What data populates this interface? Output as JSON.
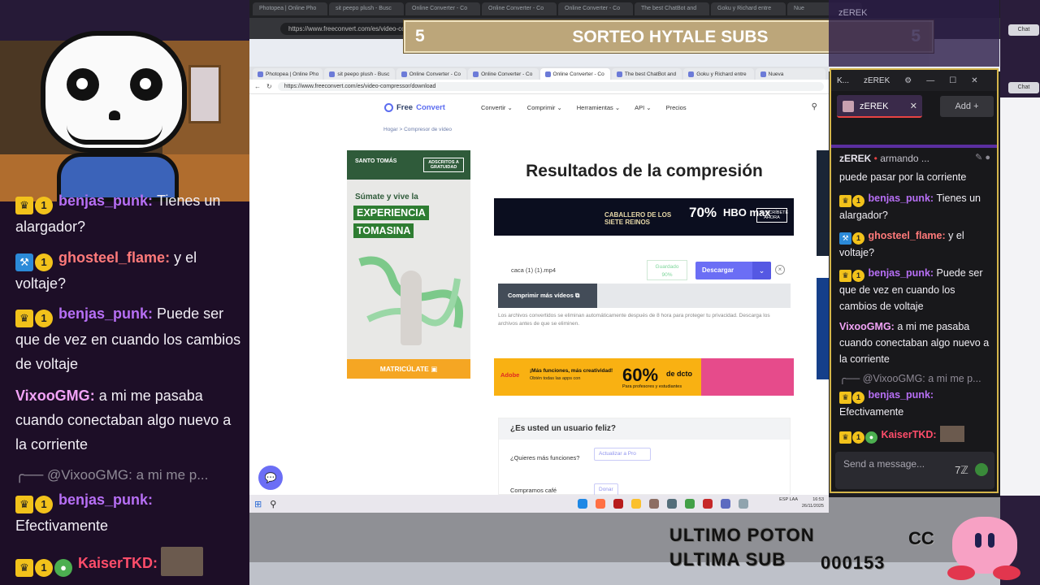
{
  "banner": {
    "left_number": "5",
    "title": "SORTEO HYTALE SUBS",
    "right_number": "5"
  },
  "bg_echo": {
    "tabs": [
      "Photopea | Online Pho",
      "sit peepo plush - Busc",
      "Online Converter - Co",
      "Online Converter - Co",
      "Online Converter - Co",
      "The best ChatBot and",
      "Goku y Richard entre",
      "Nue"
    ],
    "url": "https://www.freeconvert.com/es/video-compressor/download"
  },
  "browser": {
    "tabs": [
      "Photopea | Online Pho",
      "sit peepo plush - Busc",
      "Online Converter - Co",
      "Online Converter - Co",
      "Online Converter - Co",
      "The best ChatBot and",
      "Goku y Richard entre",
      "Nueva"
    ],
    "url": "https://www.freeconvert.com/es/video-compressor/download",
    "nav": {
      "logo_prefix": "Free",
      "logo_suffix": "Convert",
      "items": [
        "Convertir ⌄",
        "Comprimir ⌄",
        "Herramientas ⌄",
        "API ⌄",
        "Precios"
      ]
    },
    "breadcrumb": "Hogar   >   Compresor de vídeo",
    "ad_left": {
      "univ": "SANTO TOMÁS",
      "badge": "ADSCRITOS A GRATUIDAD",
      "line1": "Súmate y vive la",
      "line2": "EXPERIENCIA",
      "line3": "TOMASINA",
      "cta": "MATRICÚLATE ▣"
    },
    "results_title": "Resultados de la compresión",
    "hbo_ad": {
      "text": "CABALLERO DE LOS SIETE REINOS",
      "percent": "70%",
      "brand": "HBO max",
      "subscribe": "SUSCRÍBETE AHORA"
    },
    "file": {
      "name": "caca (1) (1).mp4",
      "saved_label": "Guardado",
      "saved_value": "90%",
      "download": "Descargar",
      "caret": "⌄",
      "close": "×"
    },
    "compress_more": "Comprimir más vídeos ⧉",
    "notice": "Los archivos convertidos se eliminan automáticamente después de 8 hora para proteger tu privacidad. Descarga los archivos antes de que se eliminen.",
    "adobe_ad": {
      "logo": "Adobe",
      "line1": "¡Más funciones, más creatividad!",
      "line2": "Obtén todas las apps con",
      "percent": "60%",
      "dcto": "de dcto",
      "sub": "Para profesores y estudiantes"
    },
    "happy": {
      "title": "¿Es usted un usuario feliz?",
      "row1": "¿Quieres más funciones?",
      "row1_btn": "Actualizar a Pro",
      "row2": "Compramos café",
      "row2_btn": "Donar"
    },
    "chat_bubble": "💬"
  },
  "taskbar": {
    "start": "⊞",
    "search": "⚲",
    "lang": "ESP LAA",
    "time": "16:53",
    "date": "26/11/2025"
  },
  "left_chat": [
    {
      "badges": [
        "crown",
        "1"
      ],
      "user": "benjas_punk",
      "text": "Tienes un alargador?",
      "color": "#b76ff5"
    },
    {
      "badges": [
        "hammer",
        "1"
      ],
      "user": "ghosteel_flame",
      "text": "y el voltaje?",
      "color": "#ff7a7a"
    },
    {
      "badges": [
        "crown",
        "1"
      ],
      "user": "benjas_punk",
      "text": "Puede ser que de vez en cuando los cambios de voltaje",
      "color": "#b76ff5"
    },
    {
      "badges": [],
      "user": "VixooGMG",
      "text": "a mi me pasaba cuando conectaban algo nuevo a la corriente",
      "color": "#f2a3f7"
    },
    {
      "reply": "╭── @VixooGMG: a mi me p..."
    },
    {
      "badges": [
        "crown",
        "1"
      ],
      "user": "benjas_punk",
      "text": "Efectivamente",
      "color": "#b76ff5"
    },
    {
      "badges": [
        "crown",
        "1",
        "frog"
      ],
      "user": "KaiserTKD",
      "text": "",
      "color": "#ff4d6a"
    }
  ],
  "right_chat": {
    "title": "zEREK",
    "title_prefix": "K...",
    "gear": "⚙",
    "min": "—",
    "max": "☐",
    "close": "✕",
    "tab": "zEREK",
    "tab_close": "✕",
    "add": "Add  +",
    "ghost_text": "zEREK",
    "streamer": "zEREK",
    "status": "armando ...",
    "messages": [
      {
        "user": "",
        "text": "puede pasar por la corriente",
        "color": "#efedf3",
        "badges": []
      },
      {
        "user": "benjas_punk",
        "text": "Tienes un alargador?",
        "color": "#b76ff5",
        "badges": [
          "crown",
          "1"
        ]
      },
      {
        "user": "ghosteel_flame",
        "text": "y el voltaje?",
        "color": "#ff7a7a",
        "badges": [
          "hammer",
          "1"
        ]
      },
      {
        "user": "benjas_punk",
        "text": "Puede ser que de vez en cuando los cambios de voltaje",
        "color": "#b76ff5",
        "badges": [
          "crown",
          "1"
        ]
      },
      {
        "user": "VixooGMG",
        "text": "a mi me pasaba cuando conectaban algo nuevo a la corriente",
        "color": "#f2a3f7",
        "badges": []
      },
      {
        "reply": "╭── @VixooGMG: a mi me p..."
      },
      {
        "user": "benjas_punk",
        "text": "Efectivamente",
        "color": "#b76ff5",
        "badges": [
          "crown",
          "1"
        ]
      },
      {
        "user": "KaiserTKD",
        "text": "",
        "color": "#ff4d6a",
        "badges": [
          "crown",
          "1",
          "frog"
        ]
      }
    ],
    "input_placeholder": "Send a message...",
    "input_icon": "7ℤ"
  },
  "right_edge": {
    "chip1": "Chat",
    "chip2": "Chat"
  },
  "overlay": {
    "line1": "ULTIMO POTON",
    "line2": "ULTIMA SUB",
    "counter": "000153",
    "cc": "CC"
  },
  "colors": {
    "banner": "#bca67a",
    "chat_bg": "#1d0e27",
    "popout_border": "#d4b54a",
    "download": "#6b6ef5"
  }
}
